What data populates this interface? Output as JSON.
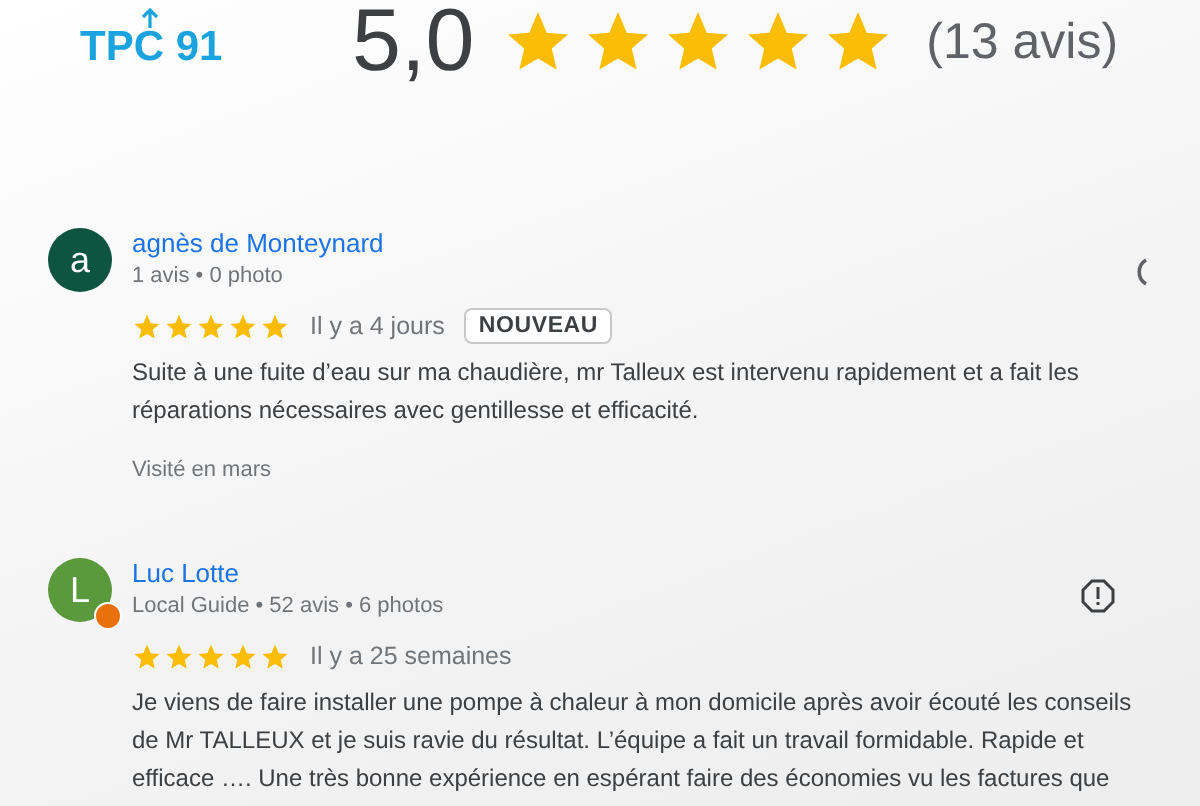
{
  "header": {
    "logo": "TPC 91",
    "rating": "5,0",
    "stars": 5,
    "count": "(13 avis)"
  },
  "reviews": [
    {
      "avatar_letter": "a",
      "color": "#0e5541",
      "local_guide": false,
      "name": "agnès de Monteynard",
      "meta": "1 avis • 0 photo",
      "stars": 5,
      "date": "Il y a 4 jours",
      "badge": "NOUVEAU",
      "text": "Suite à une fuite d’eau sur ma chaudière, mr Talleux est intervenu rapidement et a fait les réparations nécessaires avec gentillesse et efficacité.",
      "visited": "Visité en mars",
      "kind": "partial"
    },
    {
      "avatar_letter": "L",
      "color": "#5b9a3c",
      "local_guide": true,
      "name": "Luc Lotte",
      "meta": "Local Guide • 52 avis • 6 photos",
      "stars": 5,
      "date": "Il y a 25 semaines",
      "text": "Je viens de faire installer une pompe à chaleur à mon domicile après avoir écouté les conseils de Mr TALLEUX et je suis ravie du résultat. L’équipe a fait un travail formidable. Rapide et efficace …. Une très bonne expérience en espérant faire des économies vu les factures que",
      "kind": "full"
    }
  ]
}
